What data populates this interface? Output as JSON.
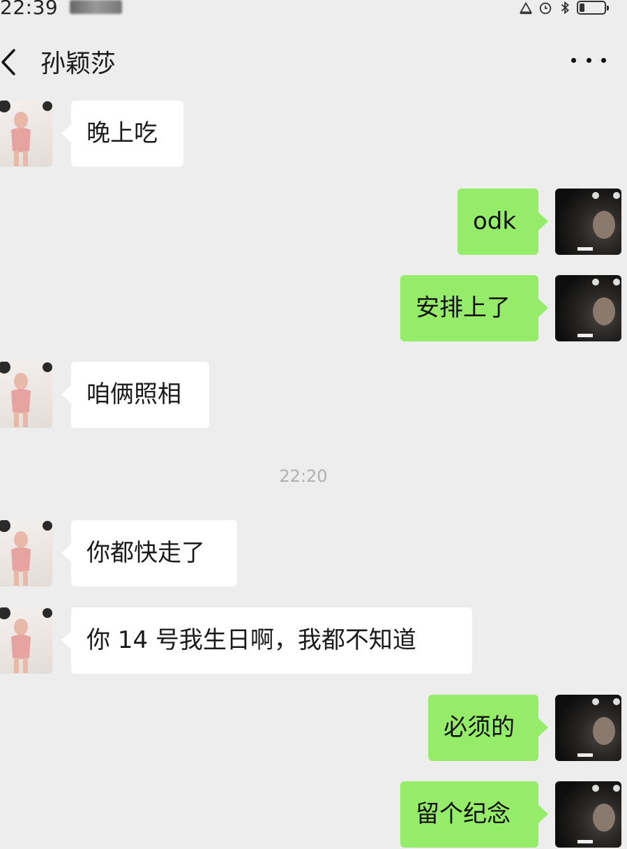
{
  "status_bar": {
    "time": "22:39",
    "icons": [
      "notification-icon",
      "alarm-icon",
      "bluetooth-icon",
      "battery-icon"
    ],
    "battery_level": 0.2
  },
  "header": {
    "title": "孙颖莎",
    "back_icon": "chevron-left-icon",
    "more_icon": "more-dots-icon"
  },
  "colors": {
    "background": "#ededed",
    "bubble_incoming": "#ffffff",
    "bubble_outgoing": "#95ec69",
    "timestamp_text": "#b0b0b0"
  },
  "messages": [
    {
      "sender": "contact",
      "text": "晚上吃"
    },
    {
      "sender": "self",
      "text": "odk"
    },
    {
      "sender": "self",
      "text": "安排上了"
    },
    {
      "sender": "contact",
      "text": "咱俩照相"
    },
    {
      "type": "timestamp",
      "text": "22:20"
    },
    {
      "sender": "contact",
      "text": "你都快走了"
    },
    {
      "sender": "contact",
      "text": "你 14 号我生日啊，我都不知道"
    },
    {
      "sender": "self",
      "text": "必须的"
    },
    {
      "sender": "self",
      "text": "留个纪念"
    }
  ]
}
